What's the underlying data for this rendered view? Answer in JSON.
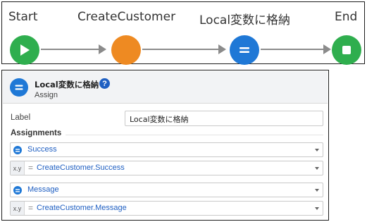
{
  "flow": {
    "nodes": [
      {
        "label": "Start",
        "icon": "play-icon",
        "color": "#2fae4e"
      },
      {
        "label": "CreateCustomer",
        "icon": "action-circle-icon",
        "color": "#ee8a22"
      },
      {
        "label": "Local変数に格納",
        "icon": "equals-icon",
        "color": "#1f78d6"
      },
      {
        "label": "End",
        "icon": "stop-icon",
        "color": "#2fae4e"
      }
    ]
  },
  "properties": {
    "title": "Local変数に格納",
    "subtitle": "Assign",
    "help": "?",
    "label_caption": "Label",
    "label_value": "Local変数に格納",
    "assignments_title": "Assignments",
    "assignments": [
      {
        "variable": "Success",
        "value_prefix": "x.y",
        "operator": "=",
        "value": "CreateCustomer.Success"
      },
      {
        "variable": "Message",
        "value_prefix": "x.y",
        "operator": "=",
        "value": "CreateCustomer.Message"
      }
    ]
  }
}
